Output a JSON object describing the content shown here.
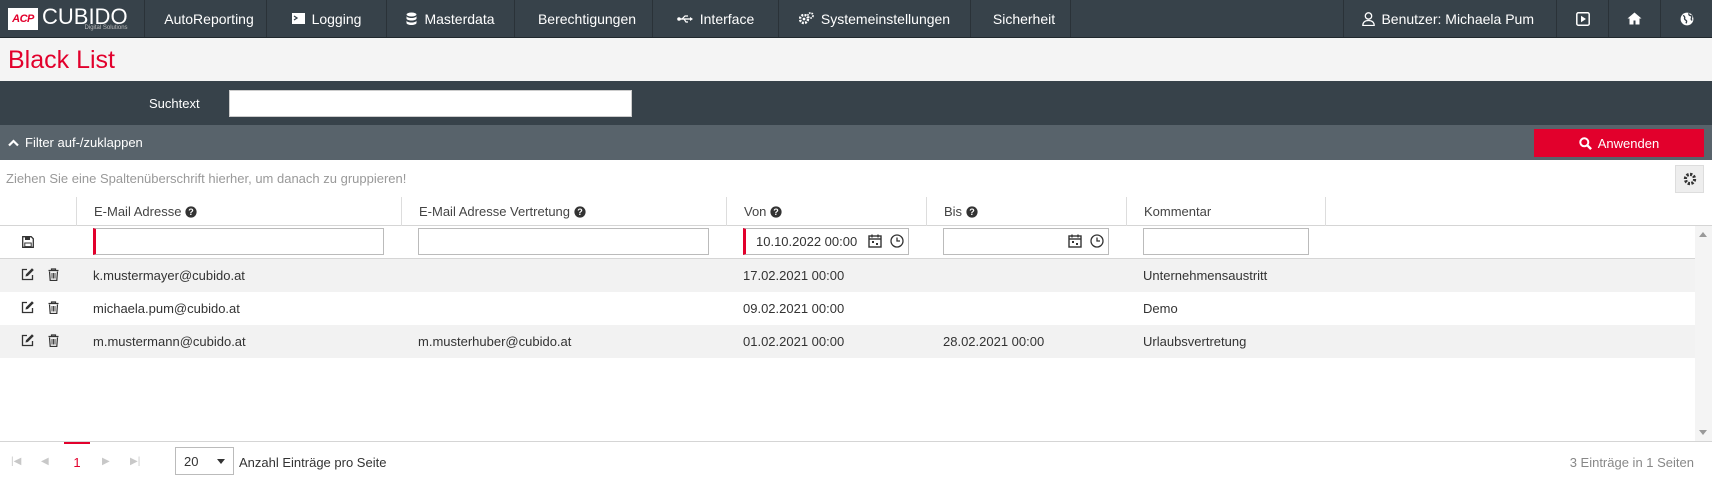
{
  "nav": {
    "logo_mark": "ACP",
    "logo_name": "CUBIDO",
    "logo_sub": "Digital Solutions",
    "items": [
      {
        "label": "AutoReporting",
        "icon": "document-icon"
      },
      {
        "label": "Logging",
        "icon": "log-icon"
      },
      {
        "label": "Masterdata",
        "icon": "database-icon"
      },
      {
        "label": "Berechtigungen",
        "icon": "eye-icon"
      },
      {
        "label": "Interface",
        "icon": "usb-icon"
      },
      {
        "label": "Systemeinstellungen",
        "icon": "gears-icon"
      },
      {
        "label": "Sicherheit",
        "icon": "shield-icon"
      }
    ],
    "user": "Benutzer: Michaela Pum"
  },
  "page": {
    "title": "Black List"
  },
  "search": {
    "label": "Suchtext",
    "value": ""
  },
  "filter": {
    "toggle_label": "Filter auf-/zuklappen",
    "apply_label": "Anwenden"
  },
  "grid": {
    "group_hint": "Ziehen Sie eine Spaltenüberschrift hierher, um danach zu gruppieren!",
    "columns": [
      "E-Mail Adresse",
      "E-Mail Adresse Vertretung",
      "Von",
      "Bis",
      "Kommentar"
    ],
    "filter_row": {
      "email": "",
      "vertretung": "",
      "von": "10.10.2022 00:00",
      "bis": "",
      "kommentar": ""
    },
    "rows": [
      {
        "email": "k.mustermayer@cubido.at",
        "vertretung": "",
        "von": "17.02.2021 00:00",
        "bis": "",
        "kommentar": "Unternehmensaustritt"
      },
      {
        "email": "michaela.pum@cubido.at",
        "vertretung": "",
        "von": "09.02.2021 00:00",
        "bis": "",
        "kommentar": "Demo"
      },
      {
        "email": "m.mustermann@cubido.at",
        "vertretung": "m.musterhuber@cubido.at",
        "von": "01.02.2021 00:00",
        "bis": "28.02.2021 00:00",
        "kommentar": "Urlaubsvertretung"
      }
    ]
  },
  "pager": {
    "current_page": "1",
    "page_size": "20",
    "page_size_label": "Anzahl Einträge pro Seite",
    "info": "3 Einträge in 1 Seiten"
  },
  "colors": {
    "accent": "#e2002c",
    "nav_bg": "#37424a",
    "filter_bg": "#58636b"
  }
}
